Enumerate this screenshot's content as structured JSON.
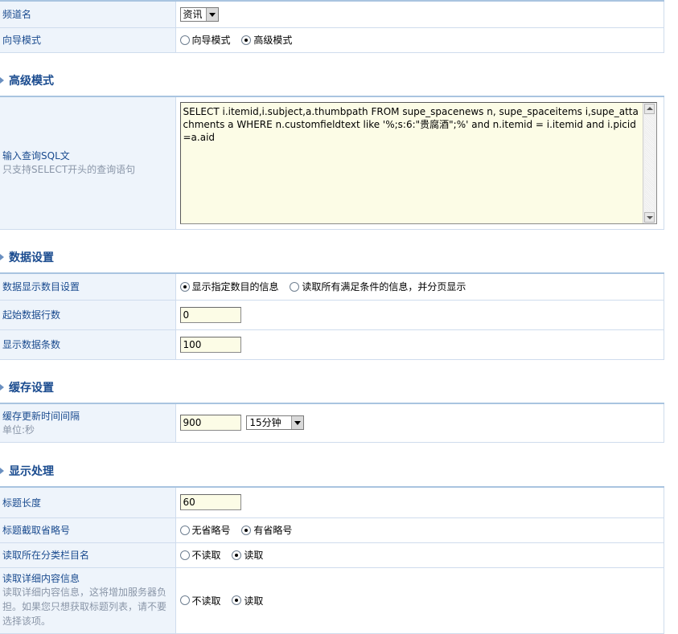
{
  "channel": {
    "label": "频道名",
    "select_value": "资讯"
  },
  "guide_mode": {
    "label": "向导模式",
    "options": [
      "向导模式",
      "高级模式"
    ],
    "selected": "高级模式"
  },
  "sections": {
    "advanced": "高级模式",
    "data": "数据设置",
    "cache": "缓存设置",
    "display": "显示处理"
  },
  "sql": {
    "label": "输入查询SQL文",
    "hint": "只支持SELECT开头的查询语句",
    "value": "SELECT i.itemid,i.subject,a.thumbpath FROM supe_spacenews n, supe_spaceitems i,supe_attachments a WHERE n.customfieldtext like '%;s:6:\"贵腐酒\";%' and n.itemid = i.itemid and i.picid=a.aid"
  },
  "data_settings": {
    "count_mode_label": "数据显示数目设置",
    "count_mode_options": [
      "显示指定数目的信息",
      "读取所有满足条件的信息，并分页显示"
    ],
    "count_mode_selected": "显示指定数目的信息",
    "start_row_label": "起始数据行数",
    "start_row_value": "0",
    "count_label": "显示数据条数",
    "count_value": "100"
  },
  "cache_settings": {
    "interval_label": "缓存更新时间间隔",
    "interval_unit": "单位:秒",
    "interval_value": "900",
    "interval_select": "15分钟"
  },
  "display_settings": {
    "title_length_label": "标题长度",
    "title_length_value": "60",
    "ellipsis_label": "标题截取省略号",
    "ellipsis_options": [
      "无省略号",
      "有省略号"
    ],
    "ellipsis_selected": "有省略号",
    "category_label": "读取所在分类栏目名",
    "category_options": [
      "不读取",
      "读取"
    ],
    "category_selected": "读取",
    "detail_label": "读取详细内容信息",
    "detail_hint": "读取详细内容信息，这将增加服务器负担。如果您只想获取标题列表，请不要选择该项。",
    "detail_options": [
      "不读取",
      "读取"
    ],
    "detail_selected": "读取"
  }
}
